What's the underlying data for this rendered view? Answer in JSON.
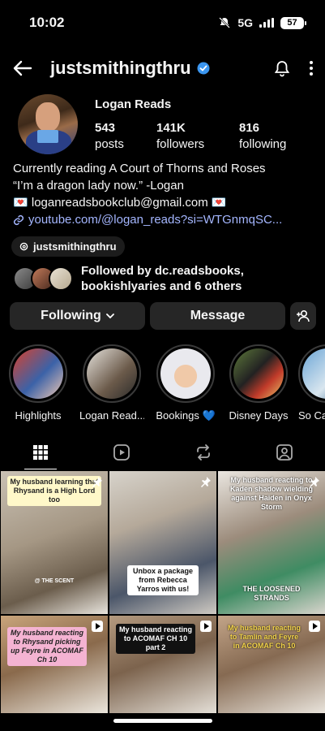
{
  "status": {
    "time": "10:02",
    "network": "5G",
    "battery": "57"
  },
  "header": {
    "username": "justsmithingthru"
  },
  "profile": {
    "display_name": "Logan Reads",
    "stats": [
      {
        "value": "543",
        "label": "posts"
      },
      {
        "value": "141K",
        "label": "followers"
      },
      {
        "value": "816",
        "label": "following"
      }
    ],
    "bio_line1": "Currently reading A Court of Thorns and Roses",
    "bio_line2": "“I’m a dragon lady now.” -Logan",
    "bio_email": "loganreadsbookclub@gmail.com",
    "link": "youtube.com/@logan_reads?si=WTGnmqSC...",
    "threads_handle": "justsmithingthru",
    "followed_by_line1": "Followed by dc.readsbooks,",
    "followed_by_line2": "bookishlyaries and 6 others"
  },
  "actions": {
    "following": "Following",
    "message": "Message"
  },
  "highlights": [
    {
      "label": "Highlights"
    },
    {
      "label": "Logan Read..."
    },
    {
      "label": "Bookings 💙"
    },
    {
      "label": "Disney Days"
    },
    {
      "label": "So Ca"
    }
  ],
  "posts": [
    {
      "caption": "My husband learning that Rhysand is a High Lord too",
      "overlay": "@ THE SCENT"
    },
    {
      "caption": "Unbox a package from Rebecca Yarros with us!"
    },
    {
      "caption": "My husband reacting to Kaden shadow wielding against Haiden in Onyx Storm",
      "overlay": "THE LOOSENED STRANDS"
    },
    {
      "caption": "My husband reacting to Rhysand picking up Feyre in ACOMAF Ch 10"
    },
    {
      "caption": "My husband reacting to ACOMAF CH 10 part 2"
    },
    {
      "caption": "My husband reacting to Tamlin and Feyre in ACOMAF Ch 10"
    }
  ]
}
